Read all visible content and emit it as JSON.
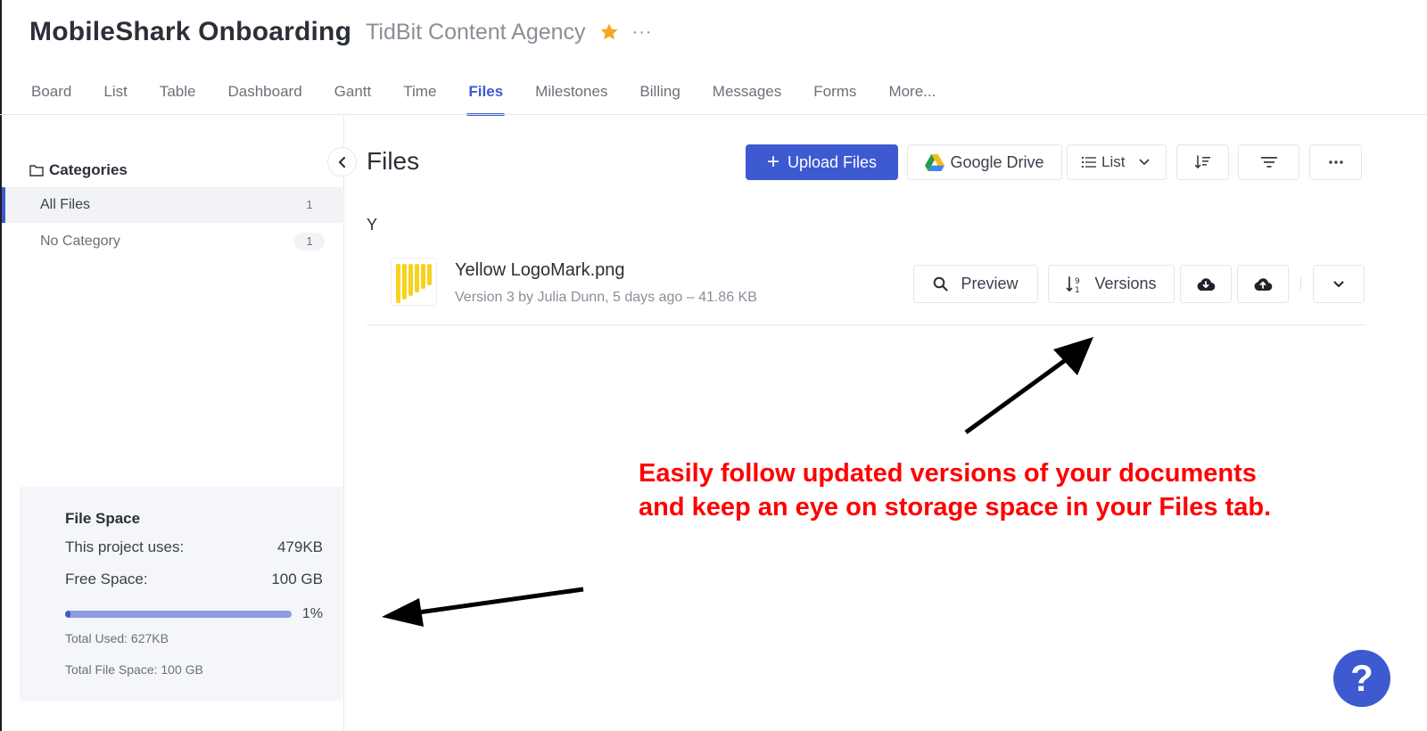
{
  "header": {
    "project_title": "MobileShark Onboarding",
    "workspace_name": "TidBit Content Agency",
    "more_label": "···",
    "star_color": "#f5a623"
  },
  "tabs": [
    {
      "label": "Board"
    },
    {
      "label": "List"
    },
    {
      "label": "Table"
    },
    {
      "label": "Dashboard"
    },
    {
      "label": "Gantt"
    },
    {
      "label": "Time"
    },
    {
      "label": "Files",
      "active": true
    },
    {
      "label": "Milestones"
    },
    {
      "label": "Billing"
    },
    {
      "label": "Messages"
    },
    {
      "label": "Forms"
    },
    {
      "label": "More..."
    }
  ],
  "sidebar": {
    "categories_label": "Categories",
    "items": [
      {
        "label": "All Files",
        "count": "1"
      },
      {
        "label": "No Category",
        "count": "1"
      }
    ],
    "file_space": {
      "title": "File Space",
      "project_uses_label": "This project uses:",
      "project_uses_value": "479KB",
      "free_space_label": "Free Space:",
      "free_space_value": "100 GB",
      "usage_percent_label": "1%",
      "usage_fraction": 0.01,
      "total_used": "Total Used: 627KB",
      "total_file_space": "Total File Space: 100 GB"
    }
  },
  "main": {
    "title": "Files",
    "toolbar": {
      "upload_label": "Upload Files",
      "google_drive_label": "Google Drive",
      "view_label": "List"
    },
    "group_letter": "Y",
    "files": [
      {
        "name": "Yellow LogoMark.png",
        "meta": "Version 3 by Julia Dunn, 5 days ago  –  41.86 KB",
        "preview_label": "Preview",
        "versions_label": "Versions"
      }
    ]
  },
  "annotation": {
    "text": "Easily follow updated versions of your documents and keep an eye on storage space in your Files tab.",
    "color": "#ff0000"
  },
  "help_label": "?",
  "colors": {
    "accent": "#3d5ad1",
    "thumb_yellow": "#f7d21c"
  }
}
